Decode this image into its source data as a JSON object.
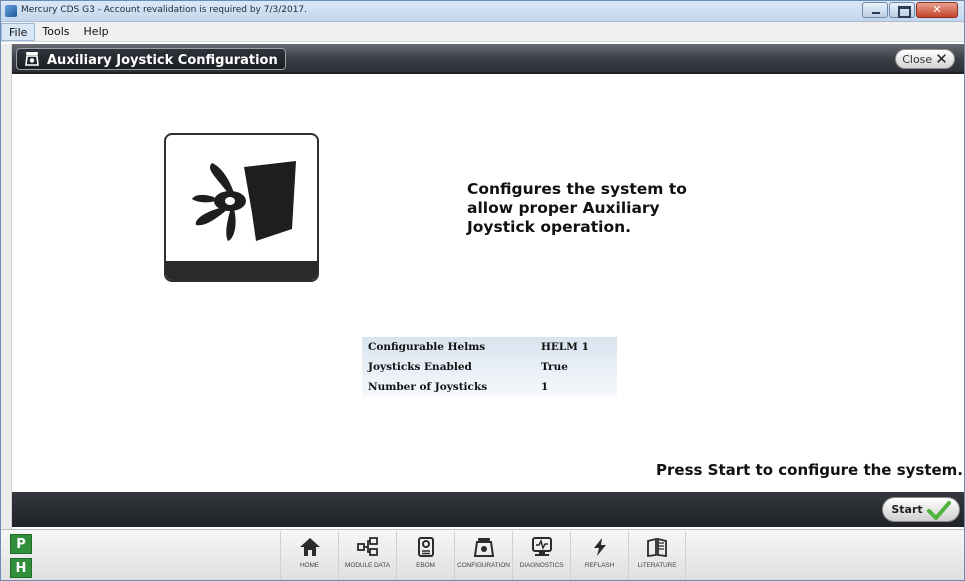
{
  "window": {
    "title": "Mercury CDS G3 - Account revalidation is required by 7/3/2017.",
    "controls": [
      "minimize",
      "maximize",
      "close"
    ]
  },
  "menubar": {
    "items": [
      {
        "label": "File",
        "selected": true
      },
      {
        "label": "Tools",
        "selected": false
      },
      {
        "label": "Help",
        "selected": false
      }
    ]
  },
  "header": {
    "icon": "configuration-icon",
    "title": "Auxiliary Joystick Configuration",
    "close_label": "Close"
  },
  "main": {
    "illustration_icon": "outdrive-propeller-icon",
    "description": "Configures the system to allow proper Auxiliary Joystick operation.",
    "table": [
      {
        "label": "Configurable Helms",
        "value": "HELM 1"
      },
      {
        "label": "Joysticks Enabled",
        "value": "True"
      },
      {
        "label": "Number of Joysticks",
        "value": "1"
      }
    ],
    "instruction": "Press Start to configure the system."
  },
  "actionbar": {
    "start_label": "Start"
  },
  "side_badges": {
    "p": "P",
    "h": "H"
  },
  "nav": {
    "items": [
      {
        "label": "HOME",
        "icon": "home-icon"
      },
      {
        "label": "MODULE DATA",
        "icon": "module-data-icon"
      },
      {
        "label": "EBOM",
        "icon": "ebom-icon"
      },
      {
        "label": "CONFIGURATION",
        "icon": "configuration-icon"
      },
      {
        "label": "DIAGNOSTICS",
        "icon": "diagnostics-icon"
      },
      {
        "label": "REFLASH",
        "icon": "reflash-icon"
      },
      {
        "label": "LITERATURE",
        "icon": "literature-icon"
      }
    ]
  }
}
